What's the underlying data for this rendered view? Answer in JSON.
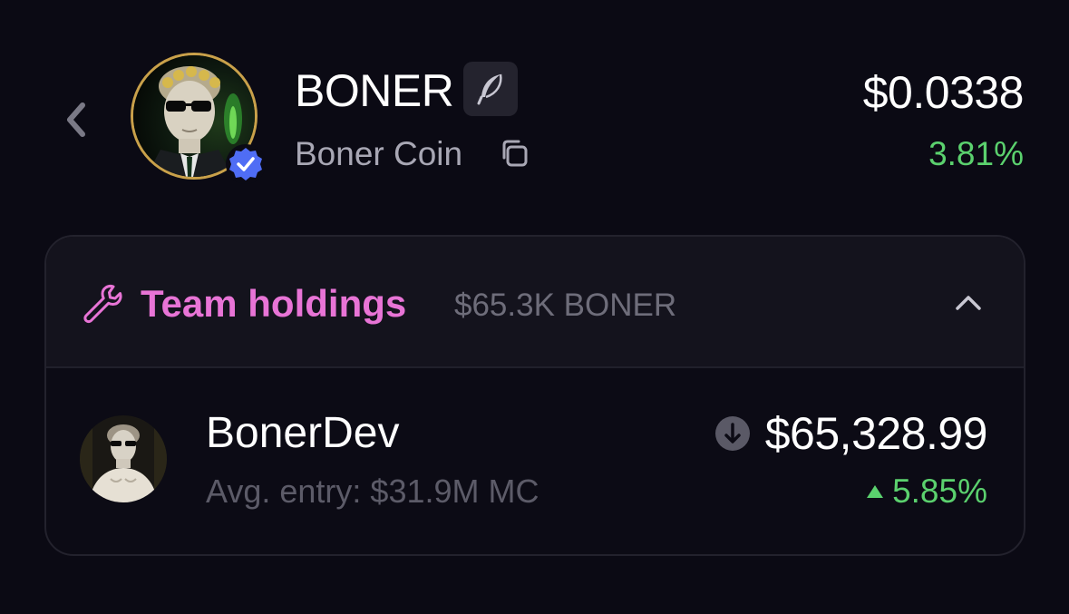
{
  "header": {
    "symbol": "BONER",
    "name": "Boner Coin",
    "price": "$0.0338",
    "change": "3.81%",
    "icons": {
      "back": "chevron-left-icon",
      "feather": "feather-icon",
      "copy": "copy-icon",
      "verified": "verified-check-icon"
    }
  },
  "team_holdings": {
    "title": "Team holdings",
    "total": "$65.3K BONER",
    "holders": [
      {
        "name": "BonerDev",
        "avg_entry": "Avg. entry: $31.9M MC",
        "value": "$65,328.99",
        "change": "5.85%",
        "direction": "up"
      }
    ]
  },
  "colors": {
    "background": "#0b0a14",
    "accent_pink": "#e874d6",
    "positive_green": "#5bd16e",
    "verified_blue": "#4f6df5",
    "avatar_border_gold": "#c9a14a"
  }
}
